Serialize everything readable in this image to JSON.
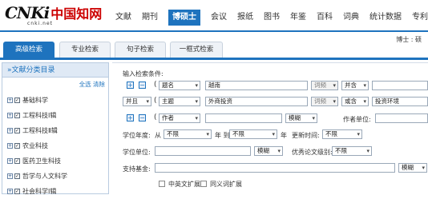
{
  "brand": {
    "logo_main": "CNKi",
    "logo_cn": "中国知网",
    "logo_sub": "cnki.net"
  },
  "nav": [
    "文献",
    "期刊",
    "博硕士",
    "会议",
    "报纸",
    "图书",
    "年鉴",
    "百科",
    "词典",
    "统计数据",
    "专利"
  ],
  "nav_active": 2,
  "tabs": [
    "高级检索",
    "专业检索",
    "句子检索",
    "一框式检索"
  ],
  "tabs_active": 0,
  "user": "博士 : 硕",
  "sidebar": {
    "title": "»文献分类目录",
    "select_all": "全选",
    "clear": "清除",
    "items": [
      "基础科学",
      "工程科技Ⅰ辑",
      "工程科技Ⅱ辑",
      "农业科技",
      "医药卫生科技",
      "哲学与人文科学",
      "社会科学Ⅰ辑"
    ]
  },
  "search": {
    "conditions_label": "输入检索条件:",
    "row1": {
      "field": "题名",
      "value": "越南",
      "freq": "词频",
      "logic": "并含"
    },
    "row2": {
      "logic1": "并且",
      "field": "主题",
      "value": "外商投资",
      "freq": "词频",
      "logic2": "或含",
      "value2": "投资环境"
    },
    "row3": {
      "field": "作者",
      "match": "模糊",
      "author_unit_label": "作者单位:"
    },
    "year_label": "学位年度:",
    "from_label": "从",
    "year_from": "不限",
    "year_mid": "年 到",
    "year_to": "不限",
    "year_end": "年",
    "update_label": "更新时间:",
    "update_value": "不限",
    "degree_unit_label": "学位单位:",
    "degree_unit_match": "模糊",
    "excellent_label": "优秀论文级别:",
    "excellent_value": "不限",
    "fund_label": "支持基金:",
    "fund_match": "模糊",
    "ext1": "中英文扩展",
    "ext2": "同义词扩展"
  }
}
